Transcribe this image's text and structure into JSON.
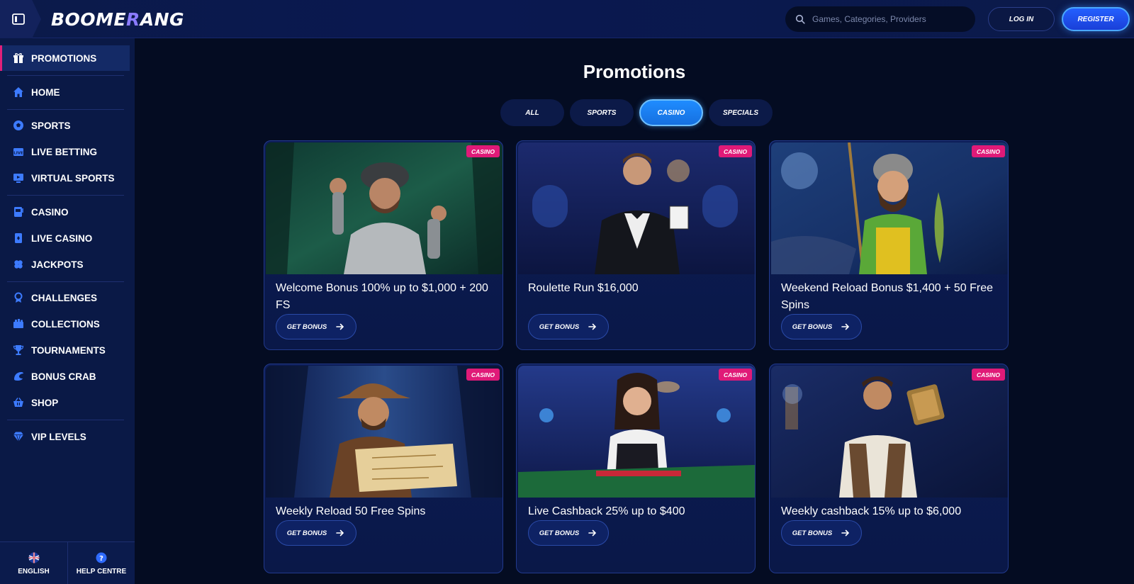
{
  "header": {
    "logo_text_a": "BOOME",
    "logo_text_b": "R",
    "logo_text_c": "ANG",
    "search_placeholder": "Games, Categories, Providers",
    "login_label": "LOG IN",
    "register_label": "REGISTER"
  },
  "sidebar": {
    "items": [
      {
        "label": "PROMOTIONS",
        "icon": "gift-icon"
      },
      {
        "label": "HOME",
        "icon": "home-icon"
      },
      {
        "label": "SPORTS",
        "icon": "soccer-ball-icon"
      },
      {
        "label": "LIVE BETTING",
        "icon": "live-icon"
      },
      {
        "label": "VIRTUAL SPORTS",
        "icon": "monitor-icon"
      },
      {
        "label": "CASINO",
        "icon": "slot-machine-icon"
      },
      {
        "label": "LIVE CASINO",
        "icon": "cards-icon"
      },
      {
        "label": "JACKPOTS",
        "icon": "clover-icon"
      },
      {
        "label": "CHALLENGES",
        "icon": "medal-icon"
      },
      {
        "label": "COLLECTIONS",
        "icon": "collection-icon"
      },
      {
        "label": "TOURNAMENTS",
        "icon": "trophy-icon"
      },
      {
        "label": "BONUS CRAB",
        "icon": "crab-claw-icon"
      },
      {
        "label": "SHOP",
        "icon": "basket-icon"
      },
      {
        "label": "VIP LEVELS",
        "icon": "diamond-icon"
      }
    ],
    "footer": {
      "language_label": "ENGLISH",
      "help_label": "HELP CENTRE"
    }
  },
  "main": {
    "title": "Promotions",
    "tabs": [
      {
        "label": "ALL"
      },
      {
        "label": "SPORTS"
      },
      {
        "label": "CASINO"
      },
      {
        "label": "SPECIALS"
      }
    ],
    "active_tab": "CASINO",
    "cards": [
      {
        "badge": "CASINO",
        "title": "Welcome Bonus 100% up to $1,000 + 200 FS",
        "button": "GET BONUS"
      },
      {
        "badge": "CASINO",
        "title": "Roulette Run $16,000",
        "button": "GET BONUS"
      },
      {
        "badge": "CASINO",
        "title": "Weekend Reload Bonus $1,400 + 50 Free Spins",
        "button": "GET BONUS"
      },
      {
        "badge": "CASINO",
        "title": "Weekly Reload 50 Free Spins",
        "button": "GET BONUS"
      },
      {
        "badge": "CASINO",
        "title": "Live Cashback 25% up to $400",
        "button": "GET BONUS"
      },
      {
        "badge": "CASINO",
        "title": "Weekly cashback 15% up to $6,000",
        "button": "GET BONUS"
      }
    ]
  },
  "colors": {
    "accent_blue": "#1f8cff",
    "badge_pink": "#e01a78",
    "background": "#040c22",
    "sidebar": "#0a1946"
  }
}
